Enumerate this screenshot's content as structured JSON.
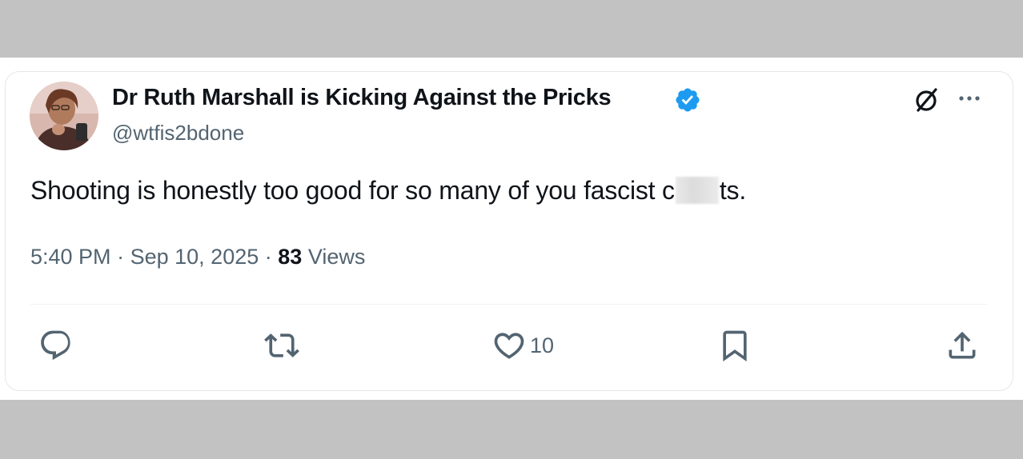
{
  "tweet": {
    "display_name": "Dr Ruth Marshall is Kicking Against the Pricks",
    "handle": "@wtfis2bdone",
    "verified_color": "#1d9bf0",
    "text_before": "Shooting is honestly too good for so many of you fascist c",
    "text_after": "ts.",
    "time": "5:40 PM",
    "separator": "·",
    "date": "Sep 10, 2025",
    "views_count": "83",
    "views_label": "Views"
  },
  "actions": {
    "reply_icon": "reply-icon",
    "retweet_icon": "retweet-icon",
    "like_icon": "like-icon",
    "like_count": "10",
    "bookmark_icon": "bookmark-icon",
    "share_icon": "share-icon"
  },
  "header_icons": {
    "grok": "grok-icon",
    "more": "more-icon"
  },
  "colors": {
    "text_primary": "#0f1419",
    "text_secondary": "#536471",
    "verified": "#1d9bf0",
    "frame": "#c2c2c2"
  }
}
